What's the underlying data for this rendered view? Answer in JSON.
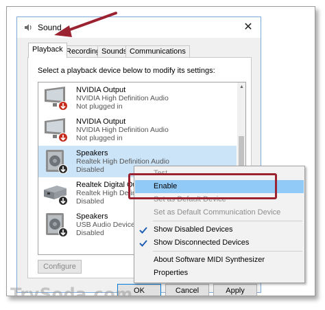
{
  "window": {
    "title": "Sound",
    "close_glyph": "✕"
  },
  "tabs": [
    {
      "label": "Playback",
      "active": true
    },
    {
      "label": "Recording",
      "active": false
    },
    {
      "label": "Sounds",
      "active": false
    },
    {
      "label": "Communications",
      "active": false
    }
  ],
  "panel": {
    "instruction": "Select a playback device below to modify its settings:"
  },
  "devices": [
    {
      "name": "NVIDIA Output",
      "driver": "NVIDIA High Definition Audio",
      "status": "Not plugged in",
      "icon": "monitor-icon",
      "selected": false
    },
    {
      "name": "NVIDIA Output",
      "driver": "NVIDIA High Definition Audio",
      "status": "Not plugged in",
      "icon": "monitor-icon",
      "selected": false
    },
    {
      "name": "Speakers",
      "driver": "Realtek High Definition Audio",
      "status": "Disabled",
      "icon": "speaker-icon",
      "selected": true
    },
    {
      "name": "Realtek Digital Out",
      "driver": "Realtek High Definition Audio",
      "status": "Disabled",
      "icon": "digital-out-icon",
      "selected": false
    },
    {
      "name": "Speakers",
      "driver": "USB Audio Device",
      "status": "Disabled",
      "icon": "speaker-icon",
      "selected": false
    }
  ],
  "buttons": {
    "configure": "Configure",
    "ok": "OK",
    "cancel": "Cancel",
    "apply": "Apply"
  },
  "context_menu": {
    "items": [
      {
        "label": "Test",
        "disabled": true,
        "checked": false,
        "highlight": false
      },
      {
        "label": "Enable",
        "disabled": false,
        "checked": false,
        "highlight": true
      },
      {
        "label": "Set as Default Device",
        "disabled": true,
        "checked": false,
        "highlight": false
      },
      {
        "label": "Set as Default Communication Device",
        "disabled": true,
        "checked": false,
        "highlight": false
      },
      {
        "label": "Show Disabled Devices",
        "disabled": false,
        "checked": true,
        "highlight": false
      },
      {
        "label": "Show Disconnected Devices",
        "disabled": false,
        "checked": true,
        "highlight": false
      },
      {
        "label": "About Software MIDI Synthesizer",
        "disabled": false,
        "checked": false,
        "highlight": false
      },
      {
        "label": "Properties",
        "disabled": false,
        "checked": false,
        "highlight": false
      }
    ]
  },
  "watermark": "TrySoda.com",
  "colors": {
    "accent": "#0078d7",
    "selection": "#cce4f7",
    "menu_highlight": "#91c9f7",
    "annotation": "#9b2230"
  }
}
